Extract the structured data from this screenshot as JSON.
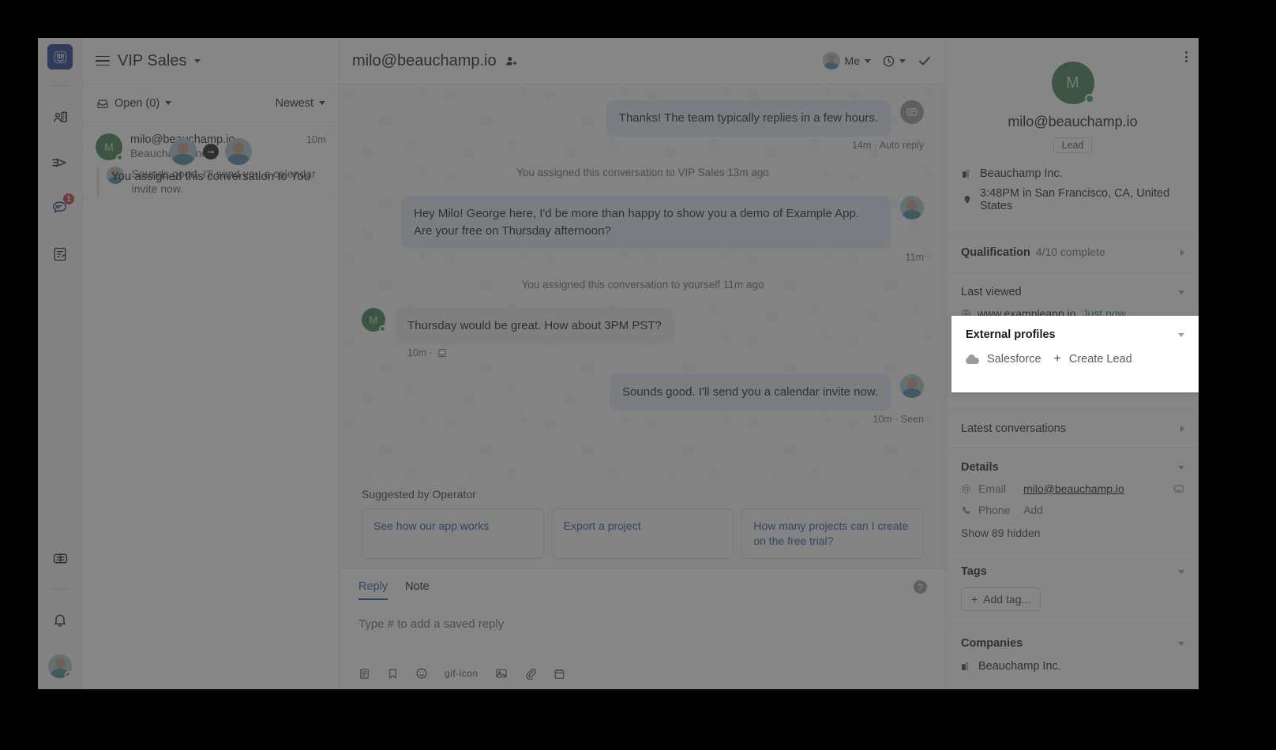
{
  "colors": {
    "brand": "#1f3a8a",
    "link": "#2b4fa8",
    "accent_green": "#2ea44f",
    "avatar_green": "#3f7d4e",
    "badge_red": "#c13a3a",
    "thread_bg": "#f6f6f7",
    "bubble_in": "#ececee",
    "bubble_out": "#dfe6f5",
    "just_now_green": "#2e7d4f"
  },
  "rail": {
    "logo_icon": "intercom-logo-icon",
    "items": [
      {
        "name": "contacts",
        "icon": "contacts-icon",
        "badge": ""
      },
      {
        "name": "outbound",
        "icon": "paper-plane-icon",
        "badge": ""
      },
      {
        "name": "inbox",
        "icon": "conversations-icon",
        "badge": "1"
      },
      {
        "name": "reports",
        "icon": "reports-icon",
        "badge": ""
      },
      {
        "name": "articles",
        "icon": "articles-icon",
        "badge": ""
      },
      {
        "name": "notifications",
        "icon": "bell-icon",
        "badge": ""
      }
    ],
    "avatar_icon": "user-avatar"
  },
  "list": {
    "menu_icon": "hamburger-icon",
    "title": "VIP Sales",
    "title_caret_icon": "chevron-down-icon",
    "filter_icon": "inbox-icon",
    "filter_label": "Open (0)",
    "filter_caret_icon": "chevron-down-icon",
    "sort_label": "Newest",
    "sort_caret_icon": "chevron-down-icon",
    "conversation": {
      "name": "milo@beauchamp.io",
      "company": "Beauchamp Inc.",
      "time": "10m",
      "snippet": "Sounds good. I'll send you a calendar invite now.",
      "avatar_initial": "M"
    },
    "assign_toast": {
      "text": "You assigned this conversation to You",
      "arrow_icon": "arrow-right-circle-icon",
      "from_avatar_icon": "user-avatar",
      "to_avatar_icon": "user-avatar"
    }
  },
  "conversation_header": {
    "title": "milo@beauchamp.io",
    "add_user_icon": "add-user-icon",
    "assignee_label": "Me",
    "assignee_avatar_icon": "user-avatar",
    "assignee_caret_icon": "chevron-down-icon",
    "snooze_icon": "clock-icon",
    "snooze_caret_icon": "chevron-down-icon",
    "close_icon": "checkmark-icon"
  },
  "thread": [
    {
      "kind": "message",
      "direction": "out",
      "text": "Thanks! The team typically replies in a few hours.",
      "meta": "14m · Auto reply",
      "avatar_icon": "operator-bot-icon"
    },
    {
      "kind": "system",
      "text": "You assigned this conversation to VIP Sales 13m ago"
    },
    {
      "kind": "message",
      "direction": "out",
      "text": "Hey Milo! George here, I'd be more than happy to show you a demo of Example App. Are your free on Thursday afternoon?",
      "meta": "11m",
      "avatar_icon": "user-avatar"
    },
    {
      "kind": "system",
      "text": "You assigned this conversation to yourself 11m ago"
    },
    {
      "kind": "message",
      "direction": "in",
      "text": "Thursday would be great. How about 3PM PST?",
      "meta": "10m ·",
      "meta_icon": "messenger-icon",
      "avatar_initial": "M"
    },
    {
      "kind": "message",
      "direction": "out",
      "text": "Sounds good. I'll send you a calendar invite now.",
      "meta": "10m · Seen",
      "avatar_icon": "user-avatar"
    }
  ],
  "suggestions": {
    "label": "Suggested by Operator",
    "chips": [
      "See how our app works",
      "Export a project",
      "How many projects can I create on the free trial?"
    ]
  },
  "composer": {
    "tabs": [
      {
        "label": "Reply",
        "active": true
      },
      {
        "label": "Note",
        "active": false
      }
    ],
    "placeholder": "Type # to add a saved reply",
    "help_icon": "question-mark-icon",
    "tools": [
      "saved-reply-icon",
      "bookmark-icon",
      "emoji-icon",
      "gif-icon",
      "image-icon",
      "attachment-icon",
      "calendar-icon"
    ]
  },
  "profile": {
    "menu_icon": "overflow-menu-icon",
    "avatar_initial": "M",
    "email": "milo@beauchamp.io",
    "role_badge": "Lead",
    "facts": [
      {
        "icon": "company-icon",
        "text": "Beauchamp Inc."
      },
      {
        "icon": "location-pin-icon",
        "text": "3:48PM in San Francisco, CA, United States"
      }
    ],
    "qualification": {
      "title": "Qualification",
      "sub": "4/10 complete",
      "chevron_icon": "chevron-right-icon"
    },
    "last_viewed": {
      "title": "Last viewed",
      "chevron_icon": "chevron-down-icon",
      "url_icon": "globe-icon",
      "url": "www.exampleapp.io",
      "when": "Just now"
    },
    "external_profiles": {
      "title": "External profiles",
      "chevron_icon": "chevron-down-icon",
      "provider_icon": "salesforce-cloud-icon",
      "provider": "Salesforce",
      "action_plus_icon": "plus-icon",
      "action_label": "Create Lead"
    },
    "latest_conversations": {
      "title": "Latest conversations",
      "chevron_icon": "chevron-right-icon"
    },
    "details": {
      "title": "Details",
      "chevron_icon": "chevron-down-icon",
      "rows": [
        {
          "icon": "at-sign-icon",
          "key": "Email",
          "value": "milo@beauchamp.io",
          "trailing_icon": "messenger-icon"
        },
        {
          "icon": "phone-icon",
          "key": "Phone",
          "value": "Add"
        }
      ],
      "show_hidden": "Show 89 hidden"
    },
    "tags": {
      "title": "Tags",
      "chevron_icon": "chevron-down-icon",
      "add_plus_icon": "plus-icon",
      "add_label": "Add tag..."
    },
    "companies": {
      "title": "Companies",
      "chevron_icon": "chevron-down-icon",
      "icon": "company-icon",
      "name": "Beauchamp Inc."
    }
  }
}
